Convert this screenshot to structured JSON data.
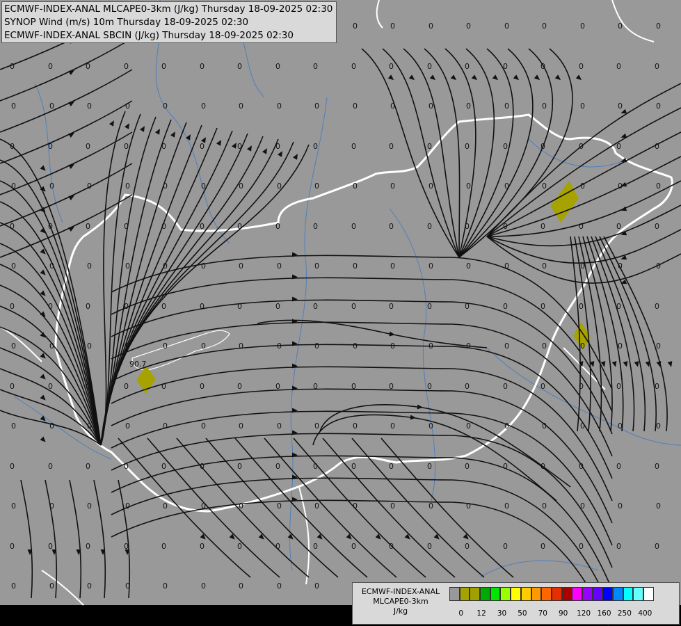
{
  "header": {
    "line1": "ECMWF-INDEX-ANAL MLCAPE0-3km (J/kg) Thursday 18-09-2025 02:30",
    "line2": "SYNOP Wind (m/s) 10m Thursday 18-09-2025 02:30",
    "line3": "ECMWF-INDEX-ANAL SBCIN (J/kg) Thursday 18-09-2025 02:30"
  },
  "legend": {
    "title": "ECMWF-INDEX-ANAL",
    "subtitle": "MLCAPE0-3km",
    "unit": "J/kg",
    "colors": [
      "#999999",
      "#a6a300",
      "#a0a000",
      "#00aa00",
      "#00e600",
      "#99ff00",
      "#ffff00",
      "#ffcc00",
      "#ff9900",
      "#ff6600",
      "#e62e00",
      "#aa0000",
      "#ff00ff",
      "#9900ff",
      "#6600ff",
      "#0000ff",
      "#0088ff",
      "#00ffff",
      "#66ffff",
      "#ffffff"
    ],
    "ticks": [
      {
        "label": "0",
        "pos": 1
      },
      {
        "label": "12",
        "pos": 3
      },
      {
        "label": "30",
        "pos": 5
      },
      {
        "label": "50",
        "pos": 7
      },
      {
        "label": "70",
        "pos": 9
      },
      {
        "label": "90",
        "pos": 11
      },
      {
        "label": "120",
        "pos": 13
      },
      {
        "label": "160",
        "pos": 15
      },
      {
        "label": "250",
        "pos": 17
      },
      {
        "label": "400",
        "pos": 19
      }
    ]
  },
  "map": {
    "background": "#999999",
    "grid_value": "0",
    "special_label": "90.7",
    "cape_fill": "#a6a300"
  }
}
